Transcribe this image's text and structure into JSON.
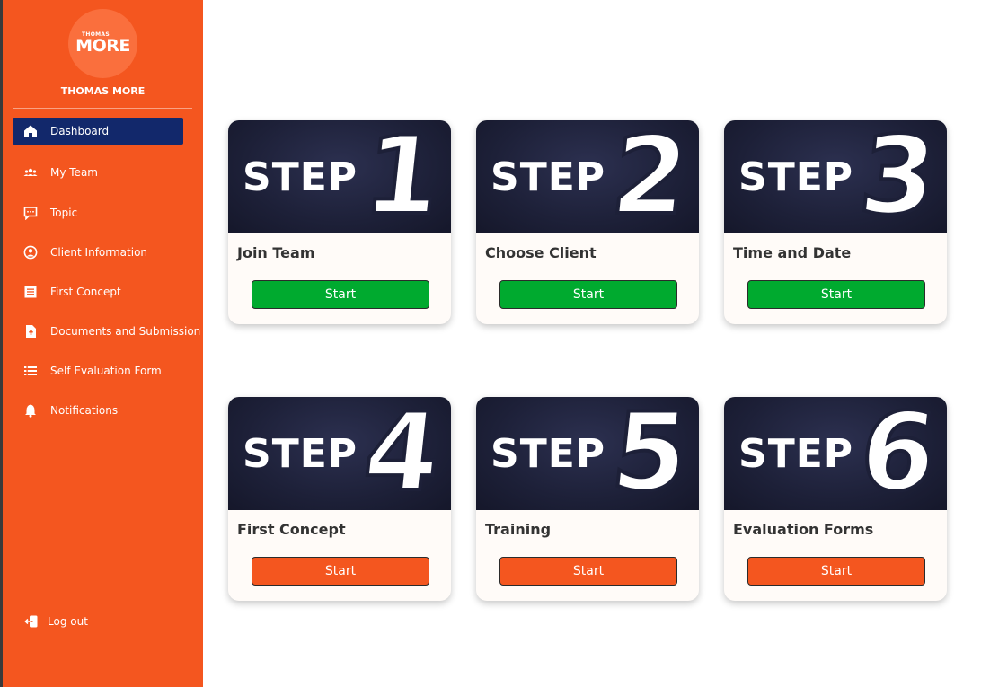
{
  "brand": {
    "logo_small": "THOMAS",
    "logo_big": "MORE",
    "name": "THOMAS MORE"
  },
  "nav": [
    {
      "label": "Dashboard",
      "icon": "home-icon",
      "active": true
    },
    {
      "label": "My Team",
      "icon": "team-icon"
    },
    {
      "label": "Topic",
      "icon": "chat-icon"
    },
    {
      "label": "Client Information",
      "icon": "user-circle-icon"
    },
    {
      "label": "First Concept",
      "icon": "document-icon"
    },
    {
      "label": "Documents and  Submission",
      "icon": "file-upload-icon"
    },
    {
      "label": "Self Evaluation Form",
      "icon": "list-icon"
    },
    {
      "label": "Notifications",
      "icon": "bell-icon"
    }
  ],
  "logout_label": "Log out",
  "cards": [
    {
      "step_word": "STEP",
      "step_number": "1",
      "title": "Join Team",
      "button": "Start",
      "status_color": "#00aa2f"
    },
    {
      "step_word": "STEP",
      "step_number": "2",
      "title": "Choose Client",
      "button": "Start",
      "status_color": "#00aa2f"
    },
    {
      "step_word": "STEP",
      "step_number": "3",
      "title": "Time and Date",
      "button": "Start",
      "status_color": "#00aa2f"
    },
    {
      "step_word": "STEP",
      "step_number": "4",
      "title": "First Concept",
      "button": "Start",
      "status_color": "#f4561f"
    },
    {
      "step_word": "STEP",
      "step_number": "5",
      "title": "Training",
      "button": "Start",
      "status_color": "#f4561f"
    },
    {
      "step_word": "STEP",
      "step_number": "6",
      "title": "Evaluation Forms",
      "button": "Start",
      "status_color": "#f4561f"
    }
  ],
  "colors": {
    "sidebar": "#f4561f",
    "active_nav": "#12286b",
    "complete": "#00aa2f",
    "pending": "#f4561f"
  }
}
